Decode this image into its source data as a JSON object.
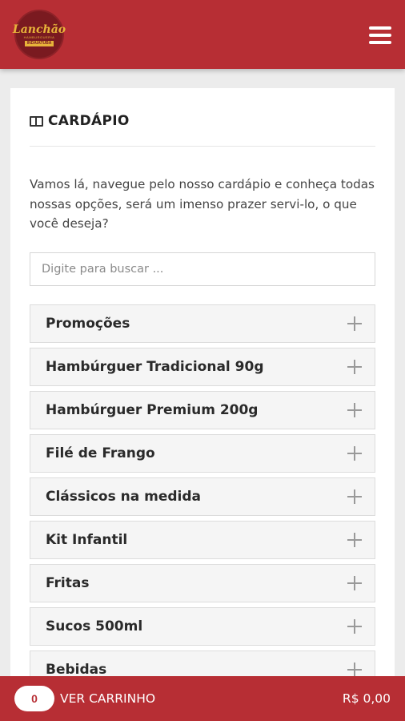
{
  "header": {
    "logo": {
      "script": "Lanchão",
      "sub": "HAMBURGUERIA",
      "city": "INDAIATUBA"
    },
    "menu_icon": "hamburger-menu-icon"
  },
  "menu_card": {
    "title": "CARDÁPIO",
    "title_icon": "book-icon",
    "intro": "Vamos lá, navegue pelo nosso cardápio e conheça todas nossas opções, será um imenso prazer servi-lo, o que você deseja?",
    "search": {
      "placeholder": "Digite para buscar ...",
      "value": ""
    },
    "categories": [
      {
        "label": "Promoções"
      },
      {
        "label": "Hambúrguer Tradicional 90g"
      },
      {
        "label": "Hambúrguer Premium 200g"
      },
      {
        "label": "Filé de Frango"
      },
      {
        "label": "Clássicos na medida"
      },
      {
        "label": "Kit Infantil"
      },
      {
        "label": "Fritas"
      },
      {
        "label": "Sucos 500ml"
      },
      {
        "label": "Bebidas"
      }
    ]
  },
  "cart": {
    "count": "0",
    "label": "VER CARRINHO",
    "total": "R$ 0,00"
  },
  "colors": {
    "brand": "#b72e34",
    "logo_bg": "#7a1a20",
    "logo_gold": "#e8b43a"
  }
}
